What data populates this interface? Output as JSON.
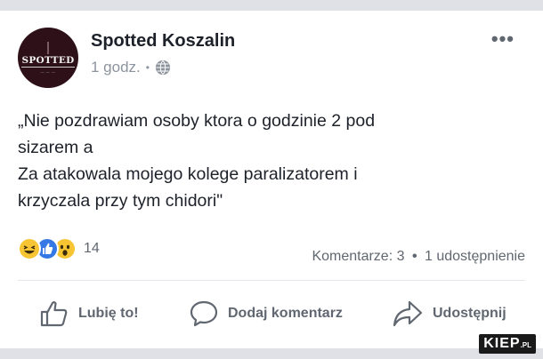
{
  "post": {
    "page_name": "Spotted Koszalin",
    "avatar_text": "SPOTTED",
    "time": "1 godz.",
    "privacy_icon": "globe-icon",
    "more_icon": "more-dots-icon",
    "text_lines": [
      "„Nie pozdrawiam osoby ktora o godzinie 2 pod",
      "sizarem a",
      "Za atakowala mojego kolege paralizatorem i",
      "krzyczala przy tym chidori\""
    ]
  },
  "reactions": {
    "icons": [
      "haha-reaction-icon",
      "like-reaction-icon",
      "wow-reaction-icon"
    ],
    "count": "14"
  },
  "stats": {
    "comments": "Komentarze: 3",
    "shares": "1 udostępnienie"
  },
  "actions": {
    "like": "Lubię to!",
    "comment": "Dodaj komentarz",
    "share": "Udostępnij"
  },
  "watermark": {
    "main": "KIEP",
    "suffix": ".PL"
  },
  "colors": {
    "text": "#1d2129",
    "muted": "#606770",
    "meta": "#8d949e",
    "like_blue": "#3578e5",
    "emoji_yellow": "#f7c533"
  }
}
